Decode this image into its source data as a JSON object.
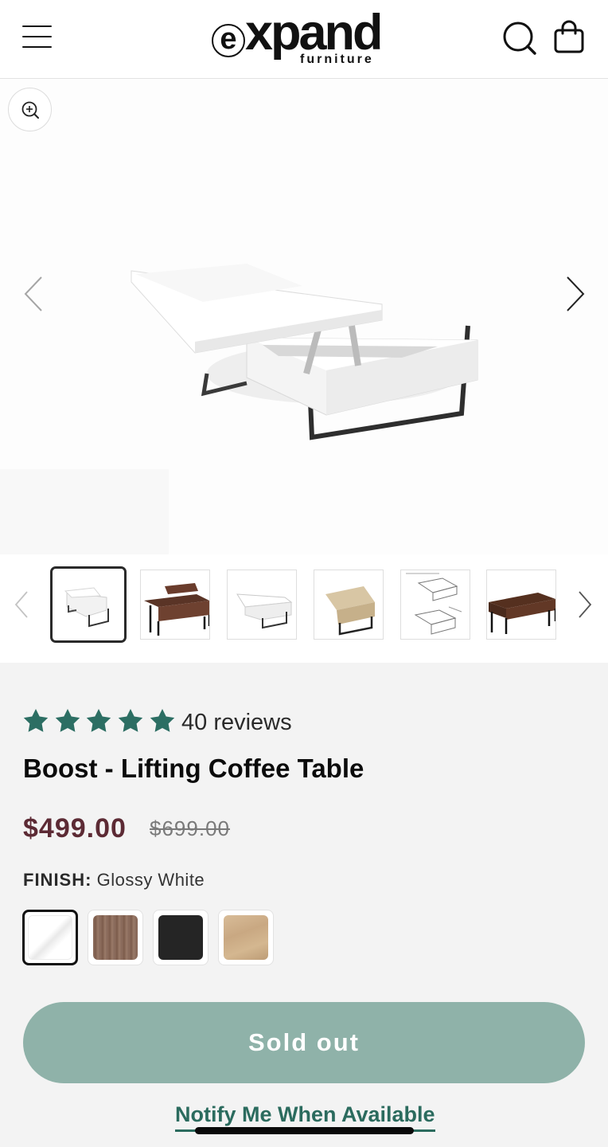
{
  "header": {
    "menu_icon": "hamburger-menu-icon",
    "logo": {
      "main": "xpand",
      "e_letter": "e",
      "sub": "furniture"
    },
    "search_icon": "search-icon",
    "cart_icon": "shopping-bag-icon"
  },
  "gallery": {
    "zoom_icon": "zoom-in-icon",
    "prev_icon": "chevron-left-icon",
    "next_icon": "chevron-right-icon",
    "selected_index": 0,
    "thumbnail_count": 6
  },
  "product": {
    "rating_stars": 5,
    "review_count_text": "40 reviews",
    "title": "Boost - Lifting Coffee Table",
    "price": "$499.00",
    "compare_at_price": "$699.00",
    "finish_label": "FINISH:",
    "finish_value": "Glossy White",
    "swatches": [
      {
        "name": "Glossy White",
        "color": "#ffffff",
        "selected": true
      },
      {
        "name": "Walnut",
        "color": "#8e6e5e",
        "selected": false
      },
      {
        "name": "Black",
        "color": "#252525",
        "selected": false
      },
      {
        "name": "Oak",
        "color": "#cdb08a",
        "selected": false
      }
    ],
    "sold_out_label": "Sold out",
    "notify_label": "Notify Me When Available"
  },
  "colors": {
    "star": "#2c6e63",
    "price": "#5c2a34",
    "sold_out_button": "#8fb2a9",
    "notify_link": "#2b6b5e"
  }
}
